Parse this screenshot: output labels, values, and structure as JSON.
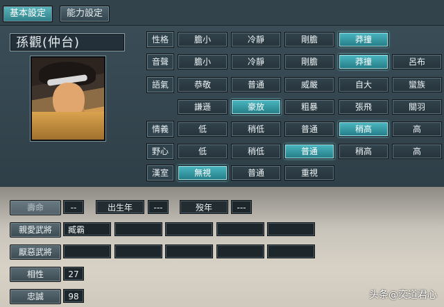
{
  "tabs": [
    {
      "label": "基本設定",
      "active": true
    },
    {
      "label": "能力設定",
      "active": false
    }
  ],
  "character": {
    "name": "孫觀(仲台)"
  },
  "attributes": [
    {
      "label": "性格",
      "options": [
        "膽小",
        "冷靜",
        "剛膽",
        "莽撞"
      ],
      "selected": 3
    },
    {
      "label": "音聲",
      "options": [
        "膽小",
        "冷靜",
        "剛膽",
        "莽撞",
        "呂布"
      ],
      "selected": 3
    },
    {
      "label": "語氣",
      "options": [
        "恭敬",
        "普通",
        "威嚴",
        "自大",
        "蠻族"
      ],
      "selected": -1
    },
    {
      "label": "",
      "options": [
        "謙遜",
        "豪放",
        "粗暴",
        "張飛",
        "關羽"
      ],
      "selected": 1
    },
    {
      "label": "情義",
      "options": [
        "低",
        "稍低",
        "普通",
        "稍高",
        "高"
      ],
      "selected": 3
    },
    {
      "label": "野心",
      "options": [
        "低",
        "稍低",
        "普通",
        "稍高",
        "高"
      ],
      "selected": 2
    },
    {
      "label": "漢室",
      "options": [
        "無視",
        "普通",
        "重視"
      ],
      "selected": 0
    }
  ],
  "lower": {
    "lifespan_label": "壽命",
    "lifespan_value": "--",
    "birth_label": "出生年",
    "birth_value": "---",
    "death_label": "歿年",
    "death_value": "---",
    "favorite_label": "親愛武將",
    "favorite_values": [
      "臧霸",
      "",
      "",
      "",
      ""
    ],
    "disliked_label": "厭惡武將",
    "disliked_values": [
      "",
      "",
      "",
      "",
      ""
    ],
    "compat_label": "相性",
    "compat_value": "27",
    "loyalty_label": "忠誠",
    "loyalty_value": "98"
  },
  "watermark": "头条@奕道君心",
  "colors": {
    "selected": "#3aa6b0",
    "panel": "#33444d"
  }
}
